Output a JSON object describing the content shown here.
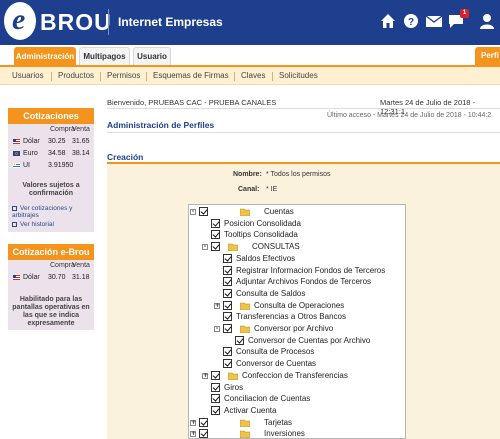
{
  "header": {
    "logo_letter": "e",
    "logo_text": "BROU",
    "app_title": "Internet Empresas",
    "notification_count": "1",
    "icons": [
      "home-icon",
      "help-icon",
      "mail-icon",
      "chat-icon",
      "user-icon"
    ]
  },
  "tabs": [
    {
      "label": "Administración",
      "active": true
    },
    {
      "label": "Multipagos",
      "active": false
    },
    {
      "label": "Usuario",
      "active": false
    }
  ],
  "tab_right_label": "Perfi",
  "subnav": [
    "Usuarios",
    "Productos",
    "Permisos",
    "Esquemas de Firmas",
    "Claves",
    "Solicitudes"
  ],
  "cotizaciones": {
    "title": "Cotizaciones",
    "col_buy": "Compra",
    "col_sell": "Venta",
    "rows": [
      {
        "currency": "Dólar",
        "buy": "30.25",
        "sell": "31.65"
      },
      {
        "currency": "Euro",
        "buy": "34.58",
        "sell": "38.14"
      },
      {
        "currency": "UI",
        "buy": "3.91950",
        "sell": ""
      }
    ],
    "note": "Valores sujetos a confirmación",
    "link_arbitrajes": "Ver cotizaciones y arbitrajes",
    "link_historial": "Ver historial"
  },
  "cotizacion_ebrou": {
    "title": "Cotización e-Brou",
    "col_buy": "Compra",
    "col_sell": "Venta",
    "rows": [
      {
        "currency": "Dólar",
        "buy": "30.70",
        "sell": "31.18"
      }
    ],
    "note": "Habilitado para las pantallas operativas en las que se indica expresamente"
  },
  "main": {
    "welcome": "Bienvenido, PRUEBAS   CAC - PRUEBA CANALES",
    "datetime": "Martes 24 de Julio de 2018 - 12:31:1",
    "last_access": "Último acceso - Martes 24 de Julio de 2018 - 10:44:2",
    "page_title": "Administración de Perfiles",
    "section_title": "Creación",
    "nombre_label": "Nombre:",
    "nombre_value": "* Todos los permisos",
    "canal_label": "Canal:",
    "canal_value": "* IE"
  },
  "tree": [
    {
      "label": "Cuentas",
      "level": 0,
      "toggle": "-",
      "folder": true
    },
    {
      "label": "Posicion Consolidada",
      "level": 1,
      "toggle": "",
      "folder": false
    },
    {
      "label": "Tooltips Consolidada",
      "level": 1,
      "toggle": "",
      "folder": false
    },
    {
      "label": "CONSULTAS",
      "level": 1,
      "toggle": "-",
      "folder": true
    },
    {
      "label": "Saldos Efectivos",
      "level": 2,
      "toggle": "",
      "folder": false
    },
    {
      "label": "Registrar Informacion Fondos de Terceros",
      "level": 2,
      "toggle": "",
      "folder": false
    },
    {
      "label": "Adjuntar Archivos Fondos de Terceros",
      "level": 2,
      "toggle": "",
      "folder": false
    },
    {
      "label": "Consulta de Saldos",
      "level": 2,
      "toggle": "",
      "folder": false
    },
    {
      "label": "Consulta de Operaciones",
      "level": 2,
      "toggle": "+",
      "folder": true
    },
    {
      "label": "Transferencias a Otros Bancos",
      "level": 2,
      "toggle": "",
      "folder": false
    },
    {
      "label": "Conversor por Archivo",
      "level": 2,
      "toggle": "-",
      "folder": true
    },
    {
      "label": "Conversor de Cuentas por Archivo",
      "level": 3,
      "toggle": "",
      "folder": false
    },
    {
      "label": "Consulta de Procesos",
      "level": 2,
      "toggle": "",
      "folder": false
    },
    {
      "label": "Conversor de Cuentas",
      "level": 2,
      "toggle": "",
      "folder": false
    },
    {
      "label": "Confeccion de Transferencias",
      "level": 1,
      "toggle": "+",
      "folder": true
    },
    {
      "label": "Giros",
      "level": 1,
      "toggle": "",
      "folder": false
    },
    {
      "label": "Conciliacion de Cuentas",
      "level": 1,
      "toggle": "",
      "folder": false
    },
    {
      "label": "Activar Cuenta",
      "level": 1,
      "toggle": "",
      "folder": false
    },
    {
      "label": "Tarjetas",
      "level": 0,
      "toggle": "+",
      "folder": true
    },
    {
      "label": "Inversiones",
      "level": 0,
      "toggle": "+",
      "folder": true
    }
  ],
  "colors": {
    "header_blue": "#1d3f8e",
    "accent_orange": "#f4941d",
    "panel_bg": "#ebe2ec",
    "form_bg": "#fbf2dd"
  }
}
